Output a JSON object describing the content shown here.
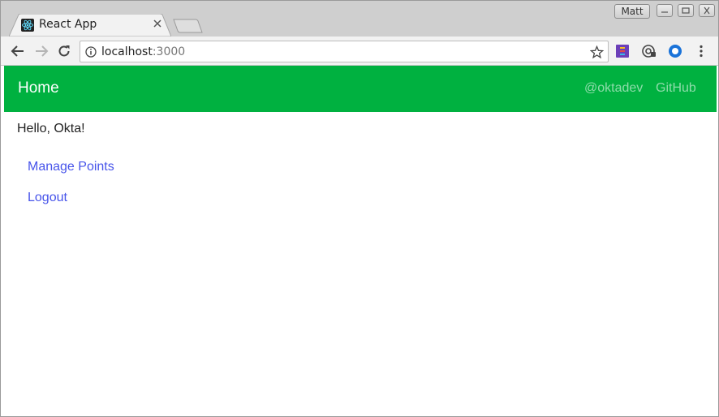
{
  "browser": {
    "tab_title": "React App",
    "profile_name": "Matt",
    "url_host": "localhost",
    "url_port": ":3000"
  },
  "app": {
    "brand": "Home",
    "nav_links": [
      "@oktadev",
      "GitHub"
    ],
    "greeting": "Hello, Okta!",
    "menu": [
      "Manage Points",
      "Logout"
    ]
  },
  "colors": {
    "navbar": "#00b140",
    "link": "#4754ea"
  }
}
